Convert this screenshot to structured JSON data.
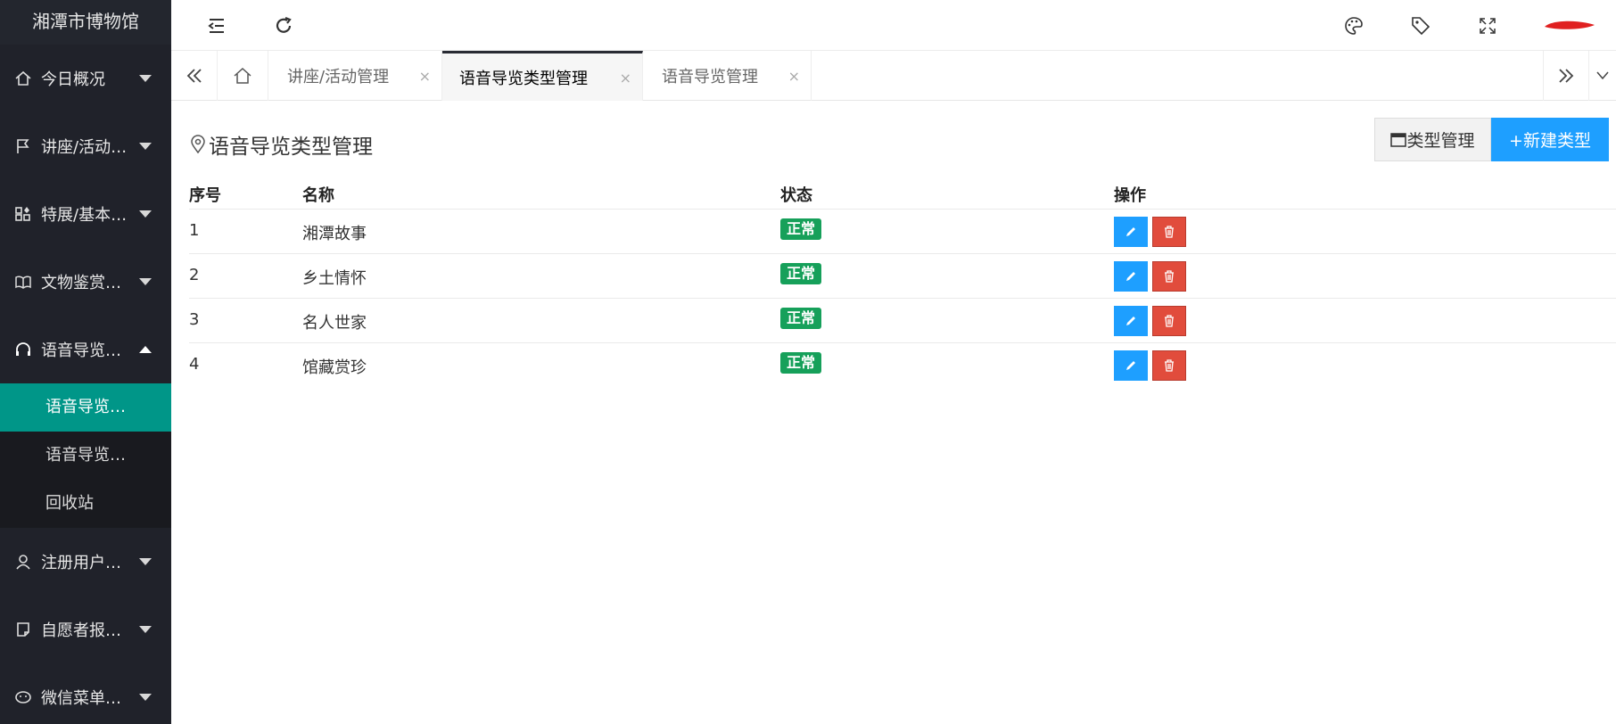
{
  "app": {
    "title": "湘潭市博物馆"
  },
  "sidebar": {
    "items": [
      {
        "label": "今日概况",
        "icon": "home-icon"
      },
      {
        "label": "讲座/活动…",
        "icon": "flag-icon"
      },
      {
        "label": "特展/基本…",
        "icon": "apps-icon"
      },
      {
        "label": "文物鉴赏…",
        "icon": "book-icon"
      },
      {
        "label": "语音导览…",
        "icon": "headphones-icon"
      }
    ],
    "submenu": [
      {
        "label": "语音导览…",
        "active": true
      },
      {
        "label": "语音导览…"
      },
      {
        "label": "回收站"
      }
    ],
    "items_after": [
      {
        "label": "注册用户…",
        "icon": "user-icon"
      },
      {
        "label": "自愿者报…",
        "icon": "note-icon"
      },
      {
        "label": "微信菜单…",
        "icon": "wechat-icon"
      }
    ]
  },
  "tabs": [
    {
      "label": "讲座/活动管理",
      "close": "×"
    },
    {
      "label": "语音导览类型管理",
      "close": "×",
      "active": true
    },
    {
      "label": "语音导览管理",
      "close": "×"
    }
  ],
  "page": {
    "title": "语音导览类型管理",
    "type_button": "类型管理",
    "new_button": "+新建类型"
  },
  "table": {
    "headers": [
      "序号",
      "名称",
      "状态",
      "操作"
    ],
    "rows": [
      {
        "index": "1",
        "name": "湘潭故事",
        "status": "正常"
      },
      {
        "index": "2",
        "name": "乡土情怀",
        "status": "正常"
      },
      {
        "index": "3",
        "name": "名人世家",
        "status": "正常"
      },
      {
        "index": "4",
        "name": "馆藏赏珍",
        "status": "正常"
      }
    ]
  },
  "colors": {
    "sidebar_bg": "#20222a",
    "active_green": "#009688",
    "primary_blue": "#1e9fff",
    "danger_red": "#e14c3c",
    "status_green": "#16a05a"
  }
}
